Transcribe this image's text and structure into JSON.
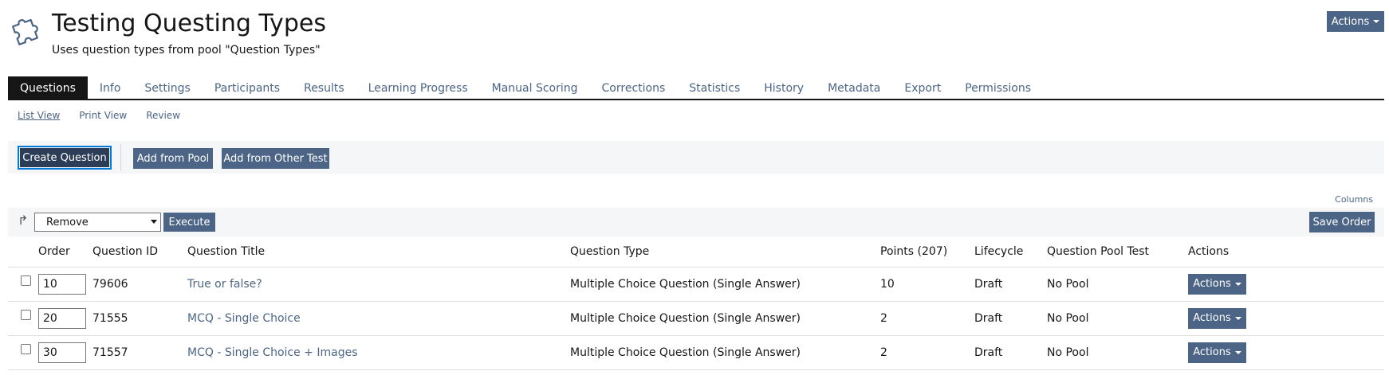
{
  "header": {
    "title": "Testing Questing Types",
    "description": "Uses question types from pool \"Question Types\"",
    "object_icon": "puzzle-icon",
    "actions_label": "Actions"
  },
  "tabs": [
    {
      "label": "Questions",
      "active": true
    },
    {
      "label": "Info"
    },
    {
      "label": "Settings"
    },
    {
      "label": "Participants"
    },
    {
      "label": "Results"
    },
    {
      "label": "Learning Progress"
    },
    {
      "label": "Manual Scoring"
    },
    {
      "label": "Corrections"
    },
    {
      "label": "Statistics"
    },
    {
      "label": "History"
    },
    {
      "label": "Metadata"
    },
    {
      "label": "Export"
    },
    {
      "label": "Permissions"
    }
  ],
  "subtabs": [
    {
      "label": "List View",
      "active": true
    },
    {
      "label": "Print View"
    },
    {
      "label": "Review"
    }
  ],
  "toolbar": {
    "create_question": "Create Question",
    "add_from_pool": "Add from Pool",
    "add_from_other_test": "Add from Other Test"
  },
  "table_controls": {
    "columns_link": "Columns",
    "multi_action_selected": "Remove",
    "execute": "Execute",
    "save_order": "Save Order"
  },
  "table": {
    "columns": [
      "Order",
      "Question ID",
      "Question Title",
      "Question Type",
      "Points (207)",
      "Lifecycle",
      "Question Pool Test",
      "Actions"
    ],
    "rows": [
      {
        "order": "10",
        "id": "79606",
        "title": "True or false?",
        "type": "Multiple Choice Question (Single Answer)",
        "points": "10",
        "lifecycle": "Draft",
        "pool": "No Pool",
        "actions": "Actions"
      },
      {
        "order": "20",
        "id": "71555",
        "title": "MCQ - Single Choice",
        "type": "Multiple Choice Question (Single Answer)",
        "points": "2",
        "lifecycle": "Draft",
        "pool": "No Pool",
        "actions": "Actions"
      },
      {
        "order": "30",
        "id": "71557",
        "title": "MCQ - Single Choice + Images",
        "type": "Multiple Choice Question (Single Answer)",
        "points": "2",
        "lifecycle": "Draft",
        "pool": "No Pool",
        "actions": "Actions"
      }
    ]
  },
  "colors": {
    "primary_button": "#4c6586",
    "active_button": "#2c3e57",
    "focus_outline": "#0078d7",
    "link": "#4c6586",
    "active_tab": "#161616"
  }
}
